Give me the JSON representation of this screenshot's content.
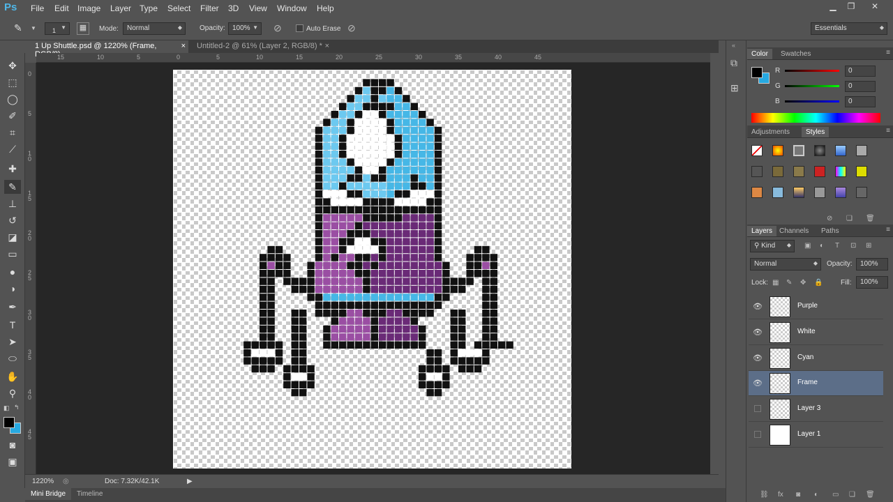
{
  "app": {
    "logo": "Ps"
  },
  "menu": [
    "File",
    "Edit",
    "Image",
    "Layer",
    "Type",
    "Select",
    "Filter",
    "3D",
    "View",
    "Window",
    "Help"
  ],
  "window": {
    "minimize": "▁",
    "restore": "❐",
    "close": "✕"
  },
  "options": {
    "brush_size": "1",
    "mode_label": "Mode:",
    "mode_value": "Normal",
    "opacity_label": "Opacity:",
    "opacity_value": "100%",
    "auto_erase": "Auto Erase",
    "workspace": "Essentials"
  },
  "tabs": [
    {
      "title": "1 Up Shuttle.psd @ 1220% (Frame, RGB/8)",
      "close": "×"
    },
    {
      "title": "Untitled-2 @ 61% (Layer 2, RGB/8) *",
      "close": "×"
    }
  ],
  "ruler": {
    "top": [
      "15",
      "10",
      "5",
      "0",
      "5",
      "10",
      "15",
      "20",
      "25",
      "30",
      "35",
      "40",
      "45"
    ],
    "left": [
      "0",
      "5",
      "1\n0",
      "1\n5",
      "2\n0",
      "2\n5",
      "3\n0",
      "3\n5",
      "4\n0",
      "4\n5"
    ]
  },
  "pixel_art": {
    "rows": [
      "............................................................",
      ".......................KKKK..................................",
      "......................KCKKCK.................................",
      ".....................KCCKCCCK................................",
      "....................KCCKKKKCCK...............................",
      "...................KCCKWWKCCCCK..............................",
      "..................KCCKWWWWKCCCCK.............................",
      ".................KCCCKWWWWKCCCCCK............................",
      ".................KCCKWWWWWWKCCCCK............................",
      ".................KCCKWWWWWWKCCCCK............................",
      ".................KCCKWWWWWWKCCCCK............................",
      ".................KCCCKWWWWKCCCCCK............................",
      ".................KCCCCKWWKCCCCCCK............................",
      ".................KCCCKKCKKCCCKCCK............................",
      ".................KCCKCCCCCCCCKKCK............................",
      ".................KWWWKKCCCCKKWWWK............................",
      ".................KKWWWWKKKKWWWWKK............................",
      ".................KKKKKKKKKKKKKKKK............................",
      ".................KPPPPPKKKKKUUUUK............................",
      ".................KPPPPKUUUUUUUUUK............................",
      ".................KPPPKKKUUUUUUUUK............................",
      ".................KPPKKWWKKUUUUUUK............................",
      "...........KK....KPPKWWWWKUUUUUUK....KK......................",
      "..........KKKK...KPKPPKKUKUUUUUUK...KKKK.....................",
      "..........KPKK..KPPPPKKUKUUUUUUUUK..KKPK.....................",
      "..........KKKK..KPPPPPKKUUUUUUUUUK..KKKK.....................",
      "..........KK.KKKKPPPPPPKUUUUUUUUUKKKK.KK.....................",
      "..........KK..KKKPPPPPPKUUUUUUUUUKKK..KK.....................",
      "..........KK....KKCCCCCCCCCCCCCCKK....KK.....................",
      "..........KK.....KKKKKKKKKKKKKKKK.....KK.....................",
      "..........KK..KK.KKKKPPKKKUUKKKK..KK..KK.....................",
      "..........KK..KK...KPPPPKUUUUK....KK..KK.....................",
      "..........KK..KK..KPPPPPKUUUUUK...KK..KK.....................",
      "..........KK..KK..KPPPPPKUUUUUK...KK..KK.....................",
      "........KKKKK.KK..KKKKKKKKKKKKK...KK.KKKKK...................",
      "........KWWWK.KK...............KK.KWWWK.....................",
      "........KKKKK.KK...............KK.KKKKK.....................",
      ".........KKK.KKKK.............KKKK.KKK......................",
      ".............KWWK.............KWWK..........................",
      ".............KKKK.............KKKK..........................",
      "..............KK...............KK..........................."
    ]
  },
  "status": {
    "zoom": "1220%",
    "doc": "Doc: 7.32K/42.1K"
  },
  "bottom_tabs": [
    "Mini Bridge",
    "Timeline"
  ],
  "color_panel": {
    "tabs": [
      "Color",
      "Swatches"
    ],
    "r_label": "R",
    "g_label": "G",
    "b_label": "B",
    "r": "0",
    "g": "0",
    "b": "0"
  },
  "styles_panel": {
    "tabs": [
      "Adjustments",
      "Styles"
    ]
  },
  "layers_panel": {
    "tabs": [
      "Layers",
      "Channels",
      "Paths"
    ],
    "kind": "Kind",
    "blend": "Normal",
    "opacity_label": "Opacity:",
    "opacity": "100%",
    "lock_label": "Lock:",
    "fill_label": "Fill:",
    "fill": "100%",
    "layers": [
      {
        "name": "Purple",
        "visible": true
      },
      {
        "name": "White",
        "visible": true
      },
      {
        "name": "Cyan",
        "visible": true
      },
      {
        "name": "Frame",
        "visible": true,
        "active": true
      },
      {
        "name": "Layer 3",
        "visible": false
      },
      {
        "name": "Layer 1",
        "visible": false
      }
    ]
  },
  "colors": {
    "cyan": "#46b7e6",
    "light_cyan": "#6cc9f0",
    "purple": "#9a4ea3",
    "dark_purple": "#6a2a77",
    "black": "#111111",
    "white": "#ffffff",
    "fg": "#000000",
    "bg": "#27a9e1"
  }
}
